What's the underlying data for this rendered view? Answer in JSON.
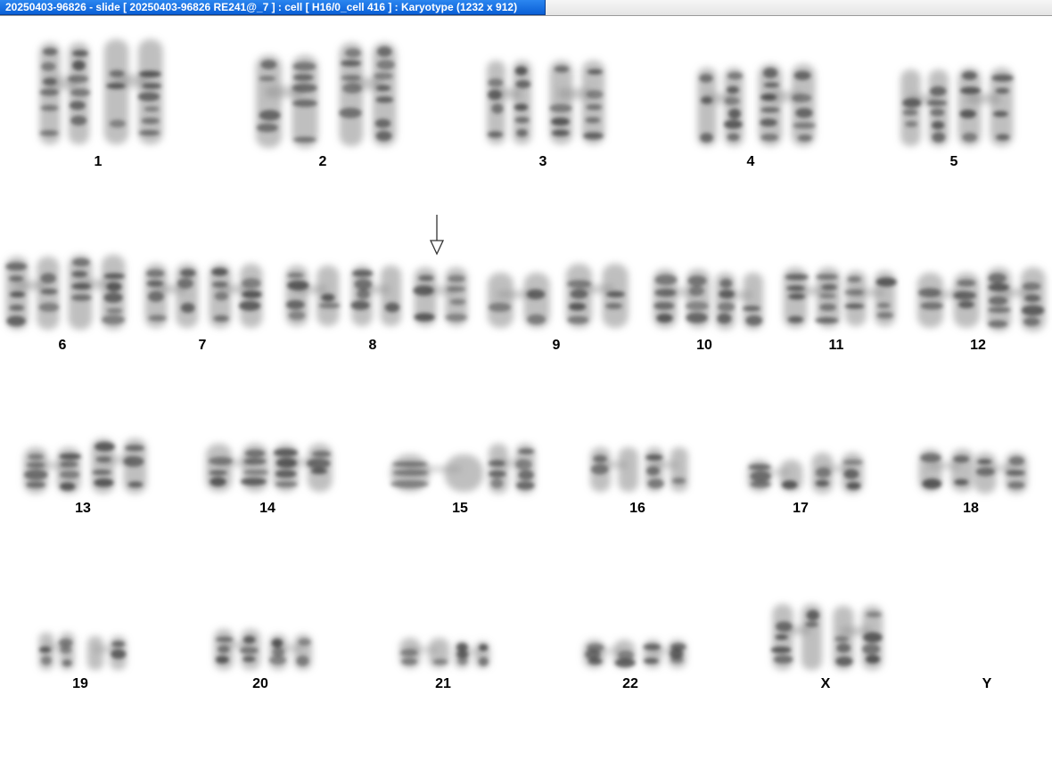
{
  "window": {
    "title": "20250403-96826 - slide [ 20250403-96826 RE241@_7 ] : cell [ H16/0_cell 416 ] : Karyotype  (1232 x 912)"
  },
  "karyotype": {
    "chromosomes": [
      {
        "label": "1",
        "count": 2
      },
      {
        "label": "2",
        "count": 2
      },
      {
        "label": "3",
        "count": 2
      },
      {
        "label": "4",
        "count": 2
      },
      {
        "label": "5",
        "count": 2
      },
      {
        "label": "6",
        "count": 2
      },
      {
        "label": "7",
        "count": 2
      },
      {
        "label": "8",
        "count": 3
      },
      {
        "label": "9",
        "count": 2
      },
      {
        "label": "10",
        "count": 2
      },
      {
        "label": "11",
        "count": 2
      },
      {
        "label": "12",
        "count": 2
      },
      {
        "label": "13",
        "count": 2
      },
      {
        "label": "14",
        "count": 2
      },
      {
        "label": "15",
        "count": 2
      },
      {
        "label": "16",
        "count": 2
      },
      {
        "label": "17",
        "count": 2
      },
      {
        "label": "18",
        "count": 2
      },
      {
        "label": "19",
        "count": 2
      },
      {
        "label": "20",
        "count": 2
      },
      {
        "label": "21",
        "count": 2
      },
      {
        "label": "22",
        "count": 2
      },
      {
        "label": "X",
        "count": 2
      },
      {
        "label": "Y",
        "count": 0
      }
    ],
    "marker": {
      "type": "down-arrow",
      "target": "8"
    }
  }
}
